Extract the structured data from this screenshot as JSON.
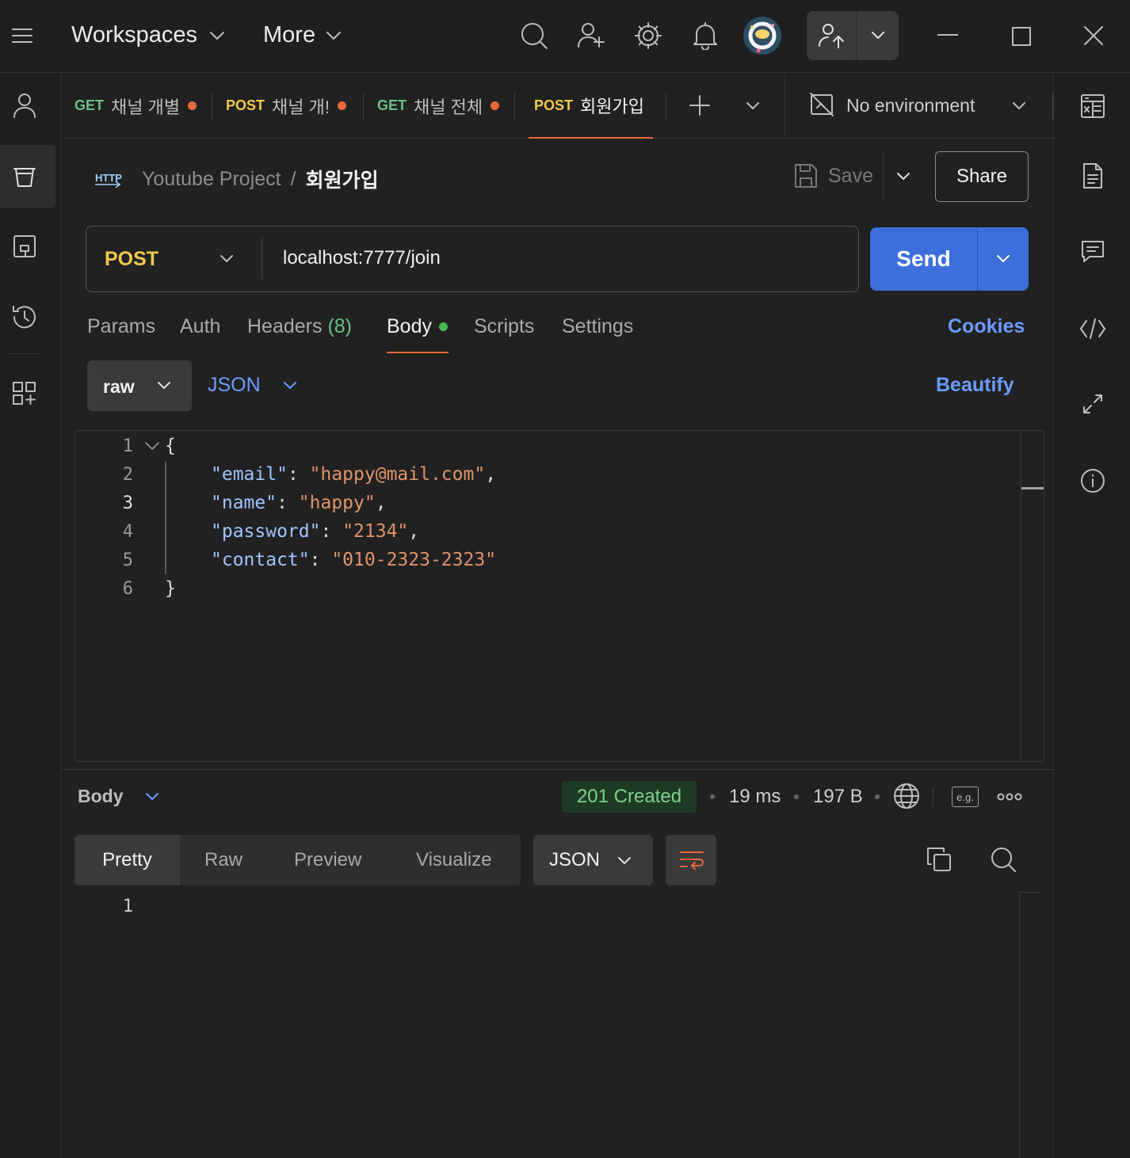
{
  "menu": {
    "workspaces": "Workspaces",
    "more": "More"
  },
  "tabs": [
    {
      "method": "GET",
      "label": "채널 개별",
      "dirty": true
    },
    {
      "method": "POST",
      "label": "채널 개!",
      "dirty": true
    },
    {
      "method": "GET",
      "label": "채널 전체",
      "dirty": true
    },
    {
      "method": "POST",
      "label": "회원가입",
      "dirty": false,
      "active": true
    }
  ],
  "environment": {
    "label": "No environment"
  },
  "breadcrumb": {
    "badge": "HTTP",
    "collection": "Youtube Project",
    "separator": "/",
    "request": "회원가입"
  },
  "header_actions": {
    "save": "Save",
    "share": "Share"
  },
  "request": {
    "method": "POST",
    "url": "localhost:7777/join",
    "send": "Send"
  },
  "request_tabs": {
    "params": "Params",
    "auth": "Auth",
    "headers": "Headers",
    "headers_count": "(8)",
    "body": "Body",
    "scripts": "Scripts",
    "settings": "Settings",
    "cookies": "Cookies"
  },
  "body_options": {
    "mode": "raw",
    "format": "JSON",
    "beautify": "Beautify"
  },
  "editor": {
    "line_numbers": [
      "1",
      "2",
      "3",
      "4",
      "5",
      "6"
    ],
    "open_brace": "{",
    "close_brace": "}",
    "fields": [
      {
        "key": "\"email\"",
        "value": "\"happy@mail.com\"",
        "comma": ","
      },
      {
        "key": "\"name\"",
        "value": "\"happy\"",
        "comma": ","
      },
      {
        "key": "\"password\"",
        "value": "\"2134\"",
        "comma": ","
      },
      {
        "key": "\"contact\"",
        "value": "\"010-2323-2323\"",
        "comma": ""
      }
    ]
  },
  "response": {
    "section": "Body",
    "status": "201 Created",
    "time": "19 ms",
    "size": "197 B",
    "eg": "e.g.",
    "view_tabs": [
      "Pretty",
      "Raw",
      "Preview",
      "Visualize"
    ],
    "format": "JSON",
    "line_numbers": [
      "1"
    ]
  },
  "colors": {
    "accent_blue": "#3d6fdc",
    "get": "#6bbf86",
    "post": "#f2c94c",
    "status_green": "#7fd18b",
    "dirty_dot": "#e8683a"
  }
}
